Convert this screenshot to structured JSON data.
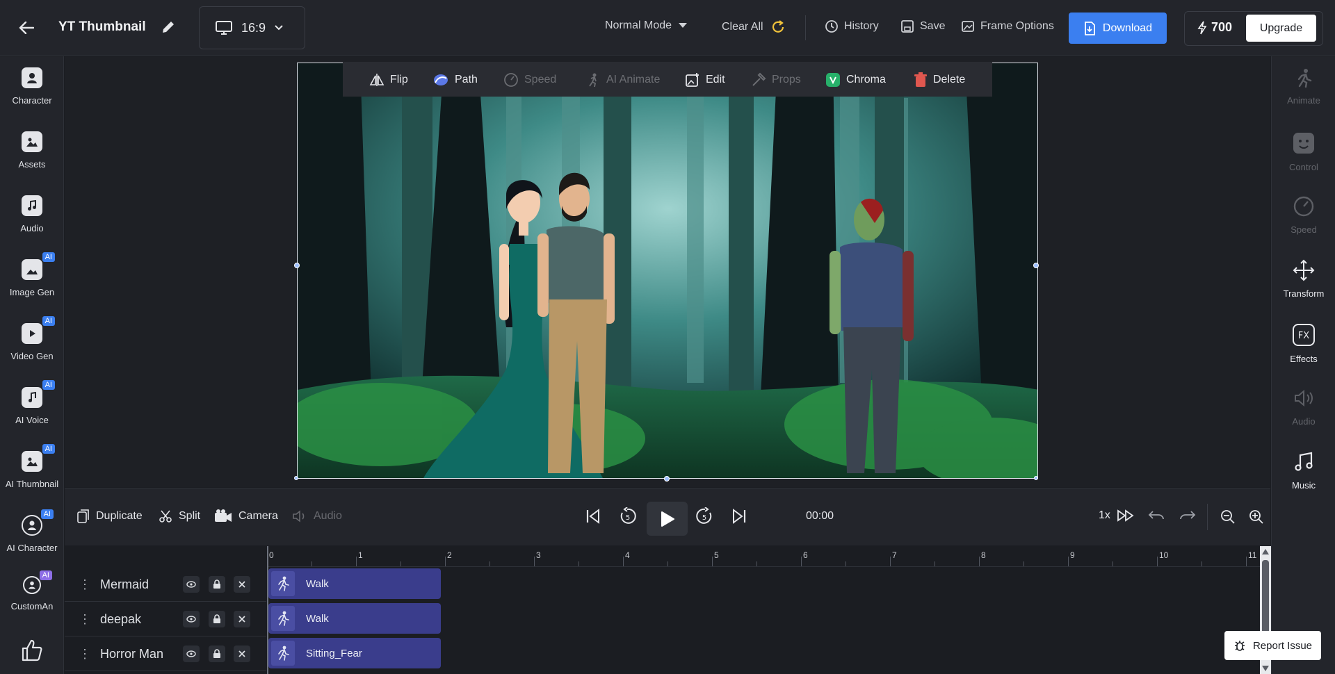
{
  "header": {
    "project_title": "YT Thumbnail",
    "aspect_ratio": "16:9",
    "mode": "Normal Mode",
    "clear_all": "Clear All",
    "history": "History",
    "save": "Save",
    "frame_options": "Frame Options",
    "download": "Download",
    "credits": "700",
    "upgrade": "Upgrade"
  },
  "left_sidebar": {
    "items": [
      {
        "label": "Character",
        "icon": "character-icon",
        "ai": false
      },
      {
        "label": "Assets",
        "icon": "assets-icon",
        "ai": false
      },
      {
        "label": "Audio",
        "icon": "audio-icon",
        "ai": false
      },
      {
        "label": "Image Gen",
        "icon": "image-gen-icon",
        "ai": true
      },
      {
        "label": "Video Gen",
        "icon": "video-gen-icon",
        "ai": true
      },
      {
        "label": "AI Voice",
        "icon": "ai-voice-icon",
        "ai": true
      },
      {
        "label": "AI Thumbnail",
        "icon": "ai-thumbnail-icon",
        "ai": true
      },
      {
        "label": "AI Character",
        "icon": "ai-character-icon",
        "ai": true
      },
      {
        "label": "CustomAn",
        "icon": "custom-animation-icon",
        "ai": true
      }
    ],
    "ai_badge": "AI"
  },
  "right_sidebar": {
    "items": [
      {
        "label": "Animate",
        "enabled": false
      },
      {
        "label": "Control",
        "enabled": false
      },
      {
        "label": "Speed",
        "enabled": false
      },
      {
        "label": "Transform",
        "enabled": true
      },
      {
        "label": "Effects",
        "enabled": true
      },
      {
        "label": "Audio",
        "enabled": false
      },
      {
        "label": "Music",
        "enabled": true
      }
    ]
  },
  "object_toolbar": {
    "flip": "Flip",
    "path": "Path",
    "speed": "Speed",
    "ai_animate": "AI Animate",
    "edit": "Edit",
    "props": "Props",
    "chroma": "Chroma",
    "delete": "Delete"
  },
  "controls": {
    "duplicate": "Duplicate",
    "split": "Split",
    "camera": "Camera",
    "audio": "Audio",
    "time": "00:00",
    "speed": "1x",
    "skip_seconds": "5"
  },
  "timeline": {
    "ticks": [
      "0",
      "1",
      "2",
      "3",
      "4",
      "5",
      "6",
      "7",
      "8",
      "9",
      "10",
      "11"
    ],
    "tracks": [
      {
        "name": "Mermaid",
        "clip": "Walk"
      },
      {
        "name": "deepak",
        "clip": "Walk"
      },
      {
        "name": "Horror Man",
        "clip": "Sitting_Fear"
      }
    ]
  },
  "report_issue": "Report Issue",
  "colors": {
    "accent": "#3b7ff0",
    "clip": "#3a3d8c",
    "panel": "#23252b"
  }
}
